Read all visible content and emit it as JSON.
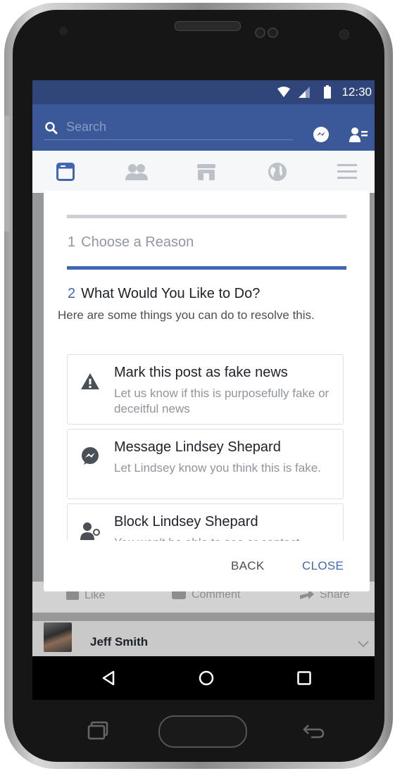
{
  "status_bar": {
    "time": "12:30"
  },
  "header": {
    "search_placeholder": "Search"
  },
  "dialog": {
    "step1_number": "1",
    "step1_label": "Choose a Reason",
    "step2_number": "2",
    "step2_label": "What Would You Like to Do?",
    "intro": "Here are some things you can do to resolve this.",
    "options": [
      {
        "title": "Mark this post as fake news",
        "subtitle": "Let us know if this is purposefully fake or deceitful news",
        "icon": "warning-icon"
      },
      {
        "title": "Message Lindsey Shepard",
        "subtitle": "Let Lindsey know you think this is fake.",
        "icon": "messenger-icon"
      },
      {
        "title": "Block Lindsey Shepard",
        "subtitle": "You won't be able to see or contact",
        "icon": "block-user-icon"
      }
    ],
    "back_label": "BACK",
    "close_label": "CLOSE"
  },
  "feed": {
    "actions": [
      "Like",
      "Comment",
      "Share"
    ],
    "post_author": "Jeff Smith"
  },
  "colors": {
    "brand": "#3b5998",
    "status_bar": "#30467a",
    "accent": "#4267b2"
  }
}
